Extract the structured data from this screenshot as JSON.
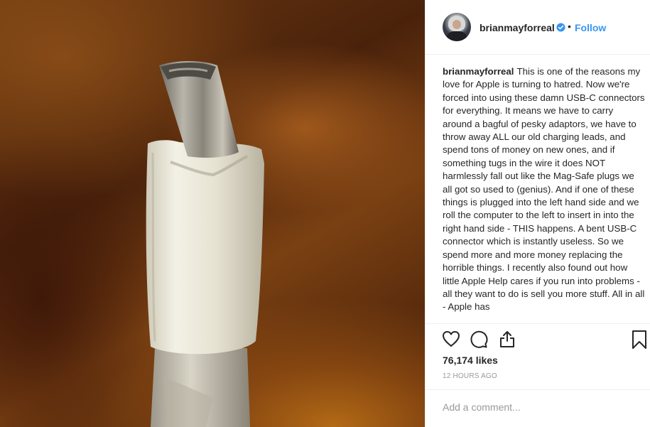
{
  "post": {
    "username": "brianmayforreal",
    "follow_label": "Follow",
    "separator": "•",
    "caption_text": "This is one of the reasons my love for Apple is turning to hatred. Now we're forced into using these damn USB-C connectors for everything. It means we have to carry around a bagful of pesky adaptors, we have to throw away ALL our old charging leads, and spend tons of money on new ones, and if something tugs in the wire it does NOT harmlessly fall out like the Mag-Safe plugs we all got so used to (genius). And if one of these things is plugged into the left hand side and we roll the computer to the left to insert in into the right hand side - THIS happens. A bent USB-C connector which is instantly useless. So we spend more and more money replacing the horrible things. I recently also found out how little Apple Help cares if you run into problems - all they want to do is sell you more stuff. All in all - Apple has",
    "likes": "76,174 likes",
    "timestamp": "12 HOURS AGO"
  },
  "comment": {
    "placeholder": "Add a comment..."
  },
  "icons": {
    "verified": "verified-badge-icon",
    "like": "heart-icon",
    "comment": "comment-bubble-icon",
    "share": "share-icon",
    "save": "bookmark-icon"
  },
  "colors": {
    "link_blue": "#3897f0",
    "text": "#262626",
    "muted": "#999999",
    "border": "#efefef"
  }
}
